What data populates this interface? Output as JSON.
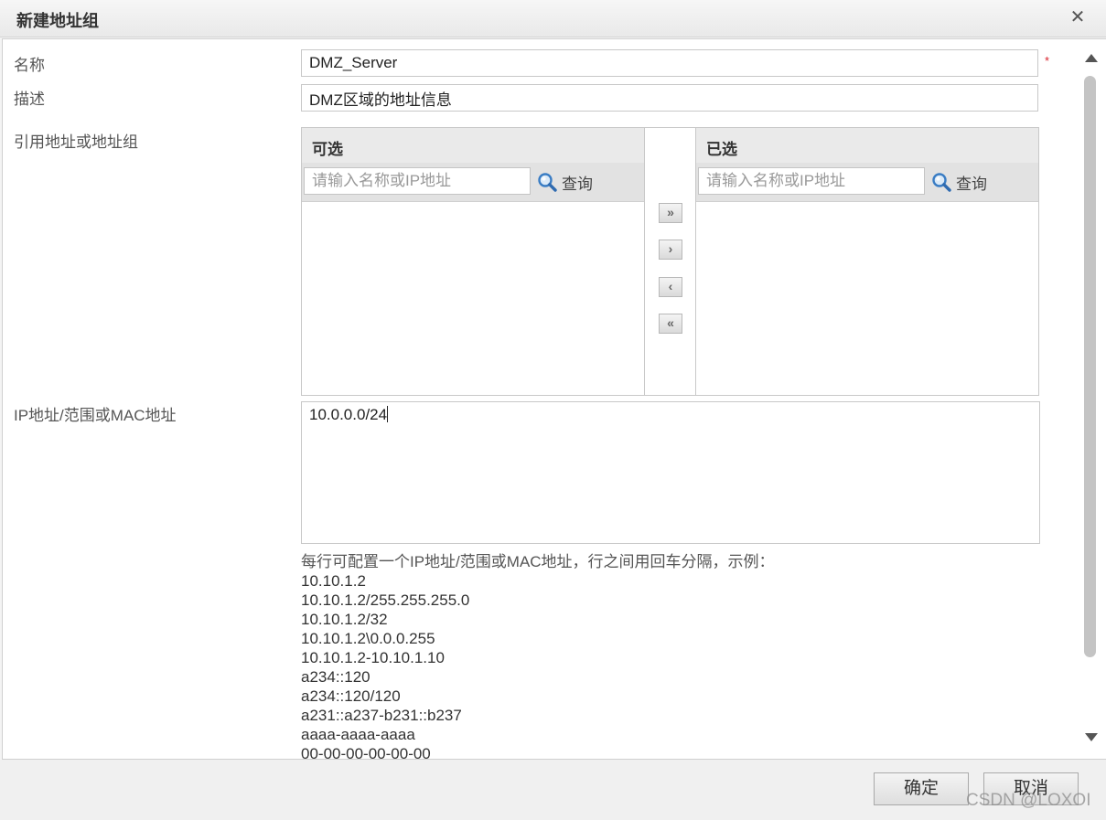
{
  "dialog": {
    "title": "新建地址组",
    "close_symbol": "✕"
  },
  "form": {
    "name_label": "名称",
    "name_value": "DMZ_Server",
    "required_mark": "*",
    "desc_label": "描述",
    "desc_value": "DMZ区域的地址信息",
    "ref_label": "引用地址或地址组",
    "ip_label": "IP地址/范围或MAC地址",
    "ip_value": "10.0.0.0/24"
  },
  "available_panel": {
    "title": "可选",
    "search_placeholder": "请输入名称或IP地址",
    "search_button": "查询"
  },
  "selected_panel": {
    "title": "已选",
    "search_placeholder": "请输入名称或IP地址",
    "search_button": "查询"
  },
  "move_buttons": {
    "add_all": "»",
    "add": "›",
    "remove": "‹",
    "remove_all": "«"
  },
  "help": {
    "intro": "每行可配置一个IP地址/范围或MAC地址，行之间用回车分隔，示例：",
    "examples": [
      "10.10.1.2",
      "10.10.1.2/255.255.255.0",
      "10.10.1.2/32",
      "10.10.1.2\\0.0.0.255",
      "10.10.1.2-10.10.1.10",
      "a234::120",
      "a234::120/120",
      "a231::a237-b231::b237",
      "aaaa-aaaa-aaaa",
      "00-00-00-00-00-00"
    ]
  },
  "footer": {
    "ok_label": "确定",
    "cancel_label": "取消"
  },
  "watermark": "CSDN @LOXOI"
}
